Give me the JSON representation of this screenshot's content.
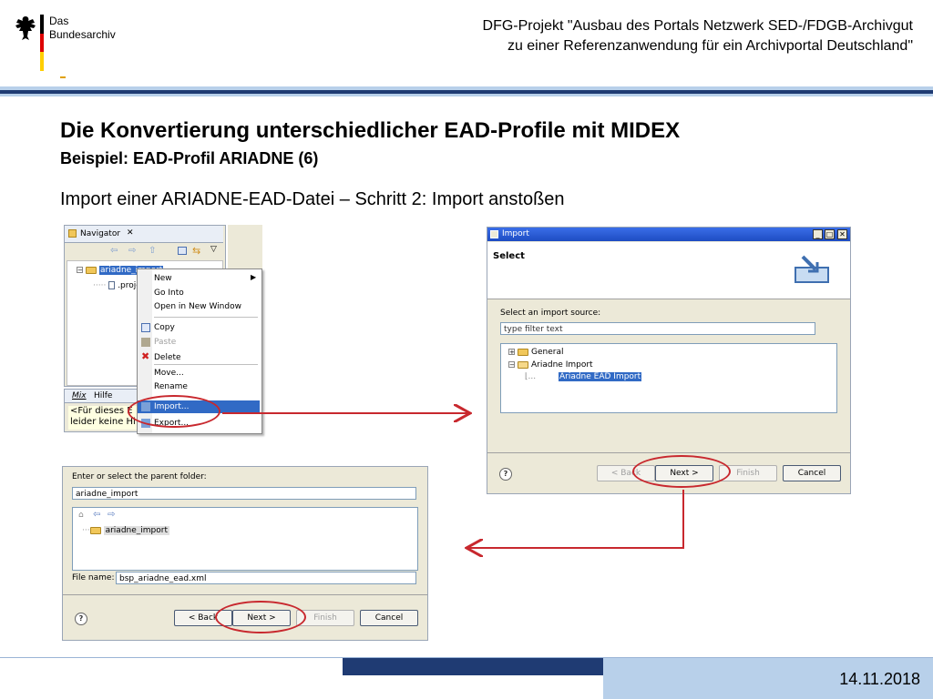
{
  "logo": {
    "line1": "Das",
    "line2": "Bundesarchiv"
  },
  "header": {
    "line1": "DFG-Projekt \"Ausbau des Portals Netzwerk SED-/FDGB-Archivgut",
    "line2": "zu einer Referenzanwendung für ein Archivportal Deutschland\""
  },
  "title": "Die Konvertierung unterschiedlicher EAD-Profile mit MIDEX",
  "subtitle": "Beispiel: EAD-Profil ARIADNE (6)",
  "step": "Import einer ARIADNE-EAD-Datei – Schritt 2: Import anstoßen",
  "navigator": {
    "tab": "Navigator",
    "close": "✕",
    "tree": {
      "project": "ariadne_import",
      "child": ".proje"
    },
    "bottom_tabs": [
      "Mix",
      "Hilfe"
    ],
    "bottom_text": [
      "<Für dieses E",
      "leider keine Hi"
    ]
  },
  "context_menu": {
    "items": [
      "New",
      "Go Into",
      "Open in New Window",
      "Copy",
      "Paste",
      "Delete",
      "Move...",
      "Rename",
      "Import...",
      "Export..."
    ]
  },
  "import_dialog": {
    "window_title": "Import",
    "heading": "Select",
    "source_label": "Select an import source:",
    "filter_placeholder": "type filter text",
    "tree": [
      "General",
      "Ariadne Import",
      "Ariadne EAD Import"
    ],
    "buttons": {
      "back": "< Back",
      "next": "Next >",
      "finish": "Finish",
      "cancel": "Cancel"
    },
    "help": "?"
  },
  "save_dialog": {
    "folder_label": "Enter or select the parent folder:",
    "folder_value": "ariadne_import",
    "tree_item": "ariadne_import",
    "file_label": "File name:",
    "file_value": "bsp_ariadne_ead.xml",
    "buttons": {
      "back": "< Back",
      "next": "Next >",
      "finish": "Finish",
      "cancel": "Cancel"
    },
    "help": "?"
  },
  "footer": {
    "date": "14.11.2018"
  },
  "colors": {
    "accent_blue": "#1f3b73",
    "light_blue": "#b8d0ea",
    "highlight_red": "#c8282e"
  }
}
